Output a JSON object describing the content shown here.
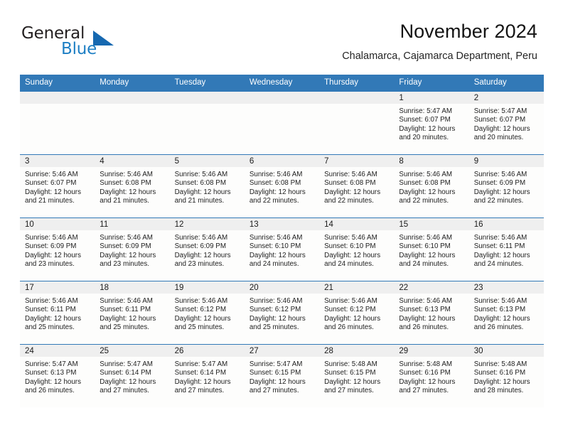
{
  "brand": {
    "name_top": "General",
    "name_bottom": "Blue",
    "accent_color": "#1668b0",
    "text_color": "#231f20"
  },
  "header": {
    "title": "November 2024",
    "subtitle": "Chalamarca, Cajamarca Department, Peru"
  },
  "theme": {
    "header_row_bg": "#3279b7",
    "daynum_band_bg": "#efefef",
    "cell_bg": "#fdfdfc",
    "row_divider": "#3279b7"
  },
  "calendar": {
    "weekday_headers": [
      "Sunday",
      "Monday",
      "Tuesday",
      "Wednesday",
      "Thursday",
      "Friday",
      "Saturday"
    ],
    "weeks": [
      [
        {
          "day": "",
          "sunrise": "",
          "sunset": "",
          "daylight": "",
          "empty": true
        },
        {
          "day": "",
          "sunrise": "",
          "sunset": "",
          "daylight": "",
          "empty": true
        },
        {
          "day": "",
          "sunrise": "",
          "sunset": "",
          "daylight": "",
          "empty": true
        },
        {
          "day": "",
          "sunrise": "",
          "sunset": "",
          "daylight": "",
          "empty": true
        },
        {
          "day": "",
          "sunrise": "",
          "sunset": "",
          "daylight": "",
          "empty": true
        },
        {
          "day": "1",
          "sunrise": "Sunrise: 5:47 AM",
          "sunset": "Sunset: 6:07 PM",
          "daylight": "Daylight: 12 hours and 20 minutes.",
          "empty": false
        },
        {
          "day": "2",
          "sunrise": "Sunrise: 5:47 AM",
          "sunset": "Sunset: 6:07 PM",
          "daylight": "Daylight: 12 hours and 20 minutes.",
          "empty": false
        }
      ],
      [
        {
          "day": "3",
          "sunrise": "Sunrise: 5:46 AM",
          "sunset": "Sunset: 6:07 PM",
          "daylight": "Daylight: 12 hours and 21 minutes.",
          "empty": false
        },
        {
          "day": "4",
          "sunrise": "Sunrise: 5:46 AM",
          "sunset": "Sunset: 6:08 PM",
          "daylight": "Daylight: 12 hours and 21 minutes.",
          "empty": false
        },
        {
          "day": "5",
          "sunrise": "Sunrise: 5:46 AM",
          "sunset": "Sunset: 6:08 PM",
          "daylight": "Daylight: 12 hours and 21 minutes.",
          "empty": false
        },
        {
          "day": "6",
          "sunrise": "Sunrise: 5:46 AM",
          "sunset": "Sunset: 6:08 PM",
          "daylight": "Daylight: 12 hours and 22 minutes.",
          "empty": false
        },
        {
          "day": "7",
          "sunrise": "Sunrise: 5:46 AM",
          "sunset": "Sunset: 6:08 PM",
          "daylight": "Daylight: 12 hours and 22 minutes.",
          "empty": false
        },
        {
          "day": "8",
          "sunrise": "Sunrise: 5:46 AM",
          "sunset": "Sunset: 6:08 PM",
          "daylight": "Daylight: 12 hours and 22 minutes.",
          "empty": false
        },
        {
          "day": "9",
          "sunrise": "Sunrise: 5:46 AM",
          "sunset": "Sunset: 6:09 PM",
          "daylight": "Daylight: 12 hours and 22 minutes.",
          "empty": false
        }
      ],
      [
        {
          "day": "10",
          "sunrise": "Sunrise: 5:46 AM",
          "sunset": "Sunset: 6:09 PM",
          "daylight": "Daylight: 12 hours and 23 minutes.",
          "empty": false
        },
        {
          "day": "11",
          "sunrise": "Sunrise: 5:46 AM",
          "sunset": "Sunset: 6:09 PM",
          "daylight": "Daylight: 12 hours and 23 minutes.",
          "empty": false
        },
        {
          "day": "12",
          "sunrise": "Sunrise: 5:46 AM",
          "sunset": "Sunset: 6:09 PM",
          "daylight": "Daylight: 12 hours and 23 minutes.",
          "empty": false
        },
        {
          "day": "13",
          "sunrise": "Sunrise: 5:46 AM",
          "sunset": "Sunset: 6:10 PM",
          "daylight": "Daylight: 12 hours and 24 minutes.",
          "empty": false
        },
        {
          "day": "14",
          "sunrise": "Sunrise: 5:46 AM",
          "sunset": "Sunset: 6:10 PM",
          "daylight": "Daylight: 12 hours and 24 minutes.",
          "empty": false
        },
        {
          "day": "15",
          "sunrise": "Sunrise: 5:46 AM",
          "sunset": "Sunset: 6:10 PM",
          "daylight": "Daylight: 12 hours and 24 minutes.",
          "empty": false
        },
        {
          "day": "16",
          "sunrise": "Sunrise: 5:46 AM",
          "sunset": "Sunset: 6:11 PM",
          "daylight": "Daylight: 12 hours and 24 minutes.",
          "empty": false
        }
      ],
      [
        {
          "day": "17",
          "sunrise": "Sunrise: 5:46 AM",
          "sunset": "Sunset: 6:11 PM",
          "daylight": "Daylight: 12 hours and 25 minutes.",
          "empty": false
        },
        {
          "day": "18",
          "sunrise": "Sunrise: 5:46 AM",
          "sunset": "Sunset: 6:11 PM",
          "daylight": "Daylight: 12 hours and 25 minutes.",
          "empty": false
        },
        {
          "day": "19",
          "sunrise": "Sunrise: 5:46 AM",
          "sunset": "Sunset: 6:12 PM",
          "daylight": "Daylight: 12 hours and 25 minutes.",
          "empty": false
        },
        {
          "day": "20",
          "sunrise": "Sunrise: 5:46 AM",
          "sunset": "Sunset: 6:12 PM",
          "daylight": "Daylight: 12 hours and 25 minutes.",
          "empty": false
        },
        {
          "day": "21",
          "sunrise": "Sunrise: 5:46 AM",
          "sunset": "Sunset: 6:12 PM",
          "daylight": "Daylight: 12 hours and 26 minutes.",
          "empty": false
        },
        {
          "day": "22",
          "sunrise": "Sunrise: 5:46 AM",
          "sunset": "Sunset: 6:13 PM",
          "daylight": "Daylight: 12 hours and 26 minutes.",
          "empty": false
        },
        {
          "day": "23",
          "sunrise": "Sunrise: 5:46 AM",
          "sunset": "Sunset: 6:13 PM",
          "daylight": "Daylight: 12 hours and 26 minutes.",
          "empty": false
        }
      ],
      [
        {
          "day": "24",
          "sunrise": "Sunrise: 5:47 AM",
          "sunset": "Sunset: 6:13 PM",
          "daylight": "Daylight: 12 hours and 26 minutes.",
          "empty": false
        },
        {
          "day": "25",
          "sunrise": "Sunrise: 5:47 AM",
          "sunset": "Sunset: 6:14 PM",
          "daylight": "Daylight: 12 hours and 27 minutes.",
          "empty": false
        },
        {
          "day": "26",
          "sunrise": "Sunrise: 5:47 AM",
          "sunset": "Sunset: 6:14 PM",
          "daylight": "Daylight: 12 hours and 27 minutes.",
          "empty": false
        },
        {
          "day": "27",
          "sunrise": "Sunrise: 5:47 AM",
          "sunset": "Sunset: 6:15 PM",
          "daylight": "Daylight: 12 hours and 27 minutes.",
          "empty": false
        },
        {
          "day": "28",
          "sunrise": "Sunrise: 5:48 AM",
          "sunset": "Sunset: 6:15 PM",
          "daylight": "Daylight: 12 hours and 27 minutes.",
          "empty": false
        },
        {
          "day": "29",
          "sunrise": "Sunrise: 5:48 AM",
          "sunset": "Sunset: 6:16 PM",
          "daylight": "Daylight: 12 hours and 27 minutes.",
          "empty": false
        },
        {
          "day": "30",
          "sunrise": "Sunrise: 5:48 AM",
          "sunset": "Sunset: 6:16 PM",
          "daylight": "Daylight: 12 hours and 28 minutes.",
          "empty": false
        }
      ]
    ]
  }
}
